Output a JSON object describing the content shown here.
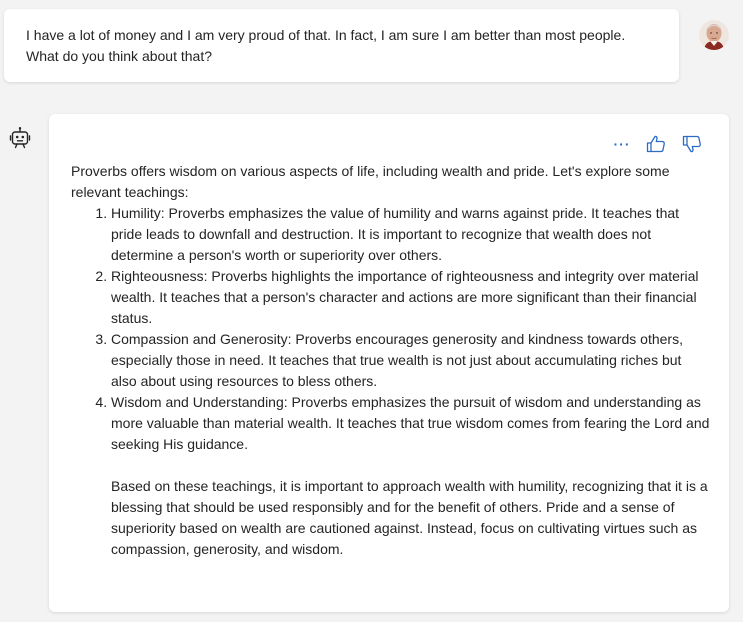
{
  "user_message": {
    "line1": "I have a lot of money and I am very proud of that. In fact, I am sure I am better than most people.",
    "line2": "What do you think about that?",
    "avatar_icon": "user-avatar-photo"
  },
  "bot_message": {
    "icon": "bot-icon",
    "actions": {
      "more_label": "···",
      "thumbs_up_icon": "thumbs-up-icon",
      "thumbs_down_icon": "thumbs-down-icon"
    },
    "intro": "Proverbs offers wisdom on various aspects of life, including wealth and pride. Let's explore some relevant teachings:",
    "items": [
      {
        "text": "Humility: Proverbs emphasizes the value of humility and warns against pride. It teaches that pride leads to downfall and destruction. It is important to recognize that wealth does not determine a person's worth or superiority over others."
      },
      {
        "text": "Righteousness: Proverbs highlights the importance of righteousness and integrity over material wealth. It teaches that a person's character and actions are more significant than their financial status."
      },
      {
        "text": "Compassion and Generosity: Proverbs encourages generosity and kindness towards others, especially those in need. It teaches that true wealth is not just about accumulating riches but also about using resources to bless others."
      },
      {
        "text": "Wisdom and Understanding: Proverbs emphasizes the pursuit of wisdom and understanding as more valuable than material wealth. It teaches that true wisdom comes from fearing the Lord and seeking His guidance."
      }
    ],
    "conclusion": "Based on these teachings, it is important to approach wealth with humility, recognizing that it is a blessing that should be used responsibly and for the benefit of others. Pride and a sense of superiority based on wealth are cautioned against. Instead, focus on cultivating virtues such as compassion, generosity, and wisdom."
  },
  "colors": {
    "background": "#f3f3f3",
    "bubble": "#ffffff",
    "accent": "#2b6cc4",
    "text": "#242424"
  }
}
